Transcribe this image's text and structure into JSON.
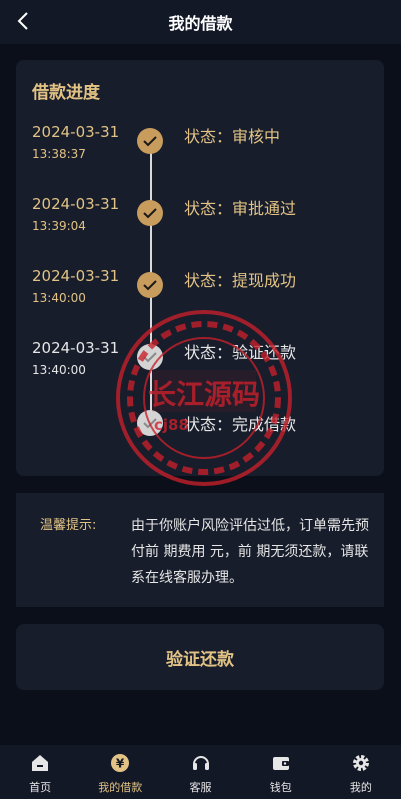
{
  "header": {
    "title": "我的借款"
  },
  "progress": {
    "title": "借款进度",
    "steps": [
      {
        "date": "2024-03-31",
        "time": "13:38:37",
        "status": "状态：审核中",
        "done": true
      },
      {
        "date": "2024-03-31",
        "time": "13:39:04",
        "status": "状态：审批通过",
        "done": true
      },
      {
        "date": "2024-03-31",
        "time": "13:40:00",
        "status": "状态：提现成功",
        "done": true
      },
      {
        "date": "2024-03-31",
        "time": "13:40:00",
        "status": "状态：验证还款",
        "done": false
      },
      {
        "date": "",
        "time": "",
        "status": "状态：完成借款",
        "done": false
      }
    ]
  },
  "notice": {
    "label": "温馨提示:",
    "text": "由于你账户风险评估过低，订单需先预付前 期费用 元，前 期无须还款，请联系在线客服办理。"
  },
  "action": {
    "label": "验证还款"
  },
  "watermark": {
    "text": "长江源码",
    "sub": "cj88"
  },
  "tabbar": {
    "items": [
      {
        "label": "首页",
        "icon": "home-icon",
        "active": false
      },
      {
        "label": "我的借款",
        "icon": "yuan-icon",
        "active": true
      },
      {
        "label": "客服",
        "icon": "headset-icon",
        "active": false
      },
      {
        "label": "钱包",
        "icon": "wallet-icon",
        "active": false
      },
      {
        "label": "我的",
        "icon": "gear-icon",
        "active": false
      }
    ]
  },
  "colors": {
    "accent": "#e2c385",
    "bg": "#0b0f19",
    "card": "#171d2b",
    "done_dot": "#c89c5c"
  }
}
